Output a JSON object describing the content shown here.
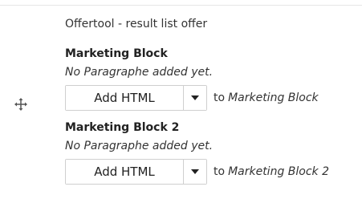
{
  "paragraph": {
    "type_label": "Offertool - result list offer"
  },
  "blocks": [
    {
      "title": "Marketing Block",
      "empty_message": "No Paragraphe added yet.",
      "add_button_label": "Add HTML",
      "to_label": "to",
      "target_name": "Marketing Block"
    },
    {
      "title": "Marketing Block 2",
      "empty_message": "No Paragraphe added yet.",
      "add_button_label": "Add HTML",
      "to_label": "to",
      "target_name": "Marketing Block 2"
    }
  ],
  "icons": {
    "drag_handle": "move-icon",
    "dropdown": "caret-down-icon"
  },
  "colors": {
    "border": "#cfcfcf",
    "text": "#222222"
  }
}
